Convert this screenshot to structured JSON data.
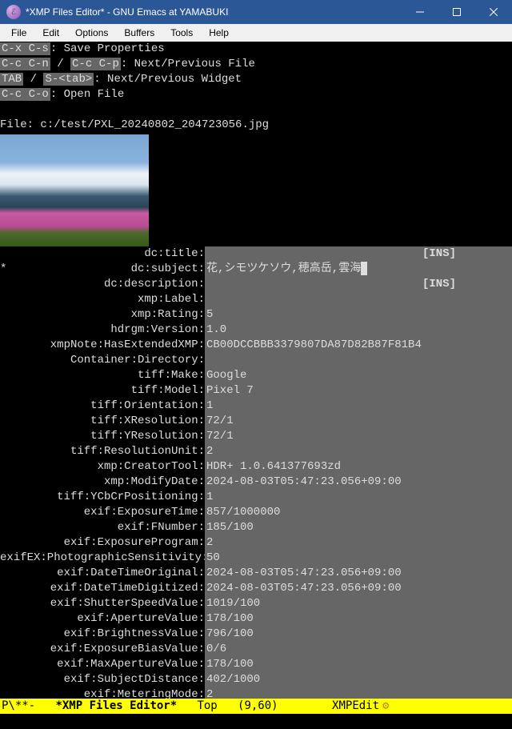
{
  "window": {
    "title": "*XMP Files Editor* - GNU Emacs at YAMABUKI"
  },
  "menubar": [
    "File",
    "Edit",
    "Options",
    "Buffers",
    "Tools",
    "Help"
  ],
  "help": {
    "l1_key": "C-x C-s",
    "l1_txt": ": Save Properties",
    "l2_k1": "C-c C-n",
    "l2_sep": " / ",
    "l2_k2": "C-c C-p",
    "l2_txt": ": Next/Previous File",
    "l3_k1": "TAB",
    "l3_sep": " / ",
    "l3_k2": "S-<tab>",
    "l3_txt": ": Next/Previous Widget",
    "l4_key": "C-c C-o",
    "l4_txt": ": Open File"
  },
  "file_line_prefix": "File: ",
  "file_path": "c:/test/PXL_20240802_204723056.jpg",
  "ins_label": "[INS]",
  "fields": [
    {
      "label": "dc:title",
      "value": "",
      "ins": true
    },
    {
      "label": "dc:subject",
      "value": "花,シモツケソウ,穂高岳,雲海",
      "star": true,
      "cursor": true
    },
    {
      "label": "dc:description",
      "value": "",
      "ins": true
    },
    {
      "label": "xmp:Label",
      "value": ""
    },
    {
      "label": "xmp:Rating",
      "value": "5"
    },
    {
      "label": "hdrgm:Version",
      "value": "1.0"
    },
    {
      "label": "xmpNote:HasExtendedXMP",
      "value": "CB00DCCBBB3379807DA87D82B87F81B4"
    },
    {
      "label": "Container:Directory",
      "value": ""
    },
    {
      "label": "tiff:Make",
      "value": "Google"
    },
    {
      "label": "tiff:Model",
      "value": "Pixel 7"
    },
    {
      "label": "tiff:Orientation",
      "value": "1"
    },
    {
      "label": "tiff:XResolution",
      "value": "72/1"
    },
    {
      "label": "tiff:YResolution",
      "value": "72/1"
    },
    {
      "label": "tiff:ResolutionUnit",
      "value": "2"
    },
    {
      "label": "xmp:CreatorTool",
      "value": "HDR+ 1.0.641377693zd"
    },
    {
      "label": "xmp:ModifyDate",
      "value": "2024-08-03T05:47:23.056+09:00"
    },
    {
      "label": "tiff:YCbCrPositioning",
      "value": "1"
    },
    {
      "label": "exif:ExposureTime",
      "value": "857/1000000"
    },
    {
      "label": "exif:FNumber",
      "value": "185/100"
    },
    {
      "label": "exif:ExposureProgram",
      "value": "2"
    },
    {
      "label": "exifEX:PhotographicSensitivity",
      "value": "50"
    },
    {
      "label": "exif:DateTimeOriginal",
      "value": "2024-08-03T05:47:23.056+09:00"
    },
    {
      "label": "exif:DateTimeDigitized",
      "value": "2024-08-03T05:47:23.056+09:00"
    },
    {
      "label": "exif:ShutterSpeedValue",
      "value": "1019/100"
    },
    {
      "label": "exif:ApertureValue",
      "value": "178/100"
    },
    {
      "label": "exif:BrightnessValue",
      "value": "796/100"
    },
    {
      "label": "exif:ExposureBiasValue",
      "value": "0/6"
    },
    {
      "label": "exif:MaxApertureValue",
      "value": "178/100"
    },
    {
      "label": "exif:SubjectDistance",
      "value": "402/1000"
    },
    {
      "label": "exif:MeteringMode",
      "value": "2"
    }
  ],
  "modeline": {
    "left": "P\\**-   ",
    "buffer": "*XMP Files Editor*",
    "pos": "   Top   (9,60)        ",
    "mode": "XMPEdit"
  }
}
